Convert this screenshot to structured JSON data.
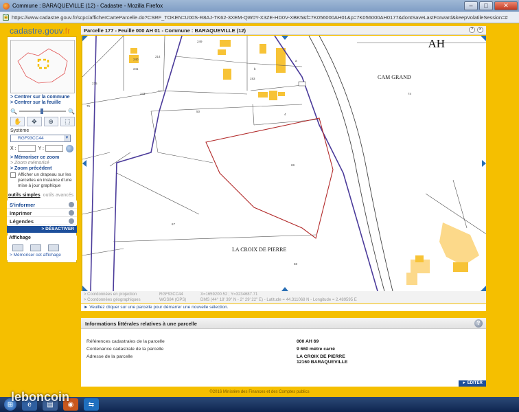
{
  "window": {
    "title": "Commune : BARAQUEVILLE (12) - Cadastre - Mozilla Firefox",
    "url_host": "cadastre.gouv.fr",
    "url": "https://www.cadastre.gouv.fr/scpc/afficherCarteParcelle.do?CSRF_TOKEN=U00S-R8AJ-TK62-3XEM-QW0Y-X3ZE-HD0V-XBK5&f=7K056000AH01&p=7K056000AH0177&dontSaveLastForward&keepVolatileSession=#"
  },
  "logo": {
    "main": "cadastre.gouv",
    "suffix": ".fr"
  },
  "map_header": {
    "title": "Parcelle 177 - Feuille 000 AH 01 - Commune : BARAQUEVILLE (12)"
  },
  "sidebar": {
    "link_commune": "> Centrer sur la commune",
    "link_feuille": "> Centrer sur la feuille",
    "systeme_label": "Système",
    "systeme_value": "RGF93CC44",
    "x_label": "X :",
    "y_label": "Y :",
    "memoriser_zoom": "> Mémoriser ce zoom",
    "zoom_memorise": "> Zoom mémorisé",
    "zoom_precedent": "> Zoom précédent",
    "drapeau_text": "Afficher un drapeau sur les parcelles en instance d'une mise à jour graphique",
    "tab_simple": "outils simples",
    "tab_avances": "outils avancés",
    "tool_informer": "S'informer",
    "tool_imprimer": "Imprimer",
    "tool_legendes": "Légendes",
    "desactiver": "> DÉSACTIVER",
    "affichage": "Affichage",
    "memoriser_affichage": "> Mémoriser cet affichage"
  },
  "map": {
    "sheet_label": "AH",
    "lieu_cam_grand": "CAM GRAND",
    "lieu_croix": "LA CROIX DE PIERRE",
    "parcel_numbers": [
      "240",
      "214",
      "215",
      "75",
      "241",
      "243",
      "249",
      "193",
      "74",
      "50",
      "69",
      "67",
      "68",
      "4",
      "b",
      "a"
    ]
  },
  "coords": {
    "proj_label": "> Coordonnées en projection",
    "proj_sys": "RGF93CC44",
    "proj_value": "X=1659200.52 ; Y=3234687.71",
    "geo_label": "> Coordonnées géographiques",
    "geo_sys": "WGS84 (GPS)",
    "geo_value": "DMS (44° 18' 39'' N - 2° 29' 22'' E) - Latitude = 44.311068 N - Longitude = 2.489595 E"
  },
  "hint": "► Veuillez cliquer sur une parcelle pour démarrer une nouvelle sélection.",
  "info": {
    "title": "Informations littérales relatives à une parcelle",
    "help": "?",
    "ref_label": "Références cadastrales de la parcelle",
    "ref_value": "000 AH 69",
    "cont_label": "Contenance cadastrale de la parcelle",
    "cont_value": "9 660 mètre carré",
    "addr_label": "Adresse de la parcelle",
    "addr_line1": "LA CROIX DE PIERRE",
    "addr_line2": "12160 BARAQUEVILLE",
    "editer": "► EDITER"
  },
  "footer": "©2016 Ministère des Finances et des Comptes publics",
  "watermark": "leboncoin"
}
